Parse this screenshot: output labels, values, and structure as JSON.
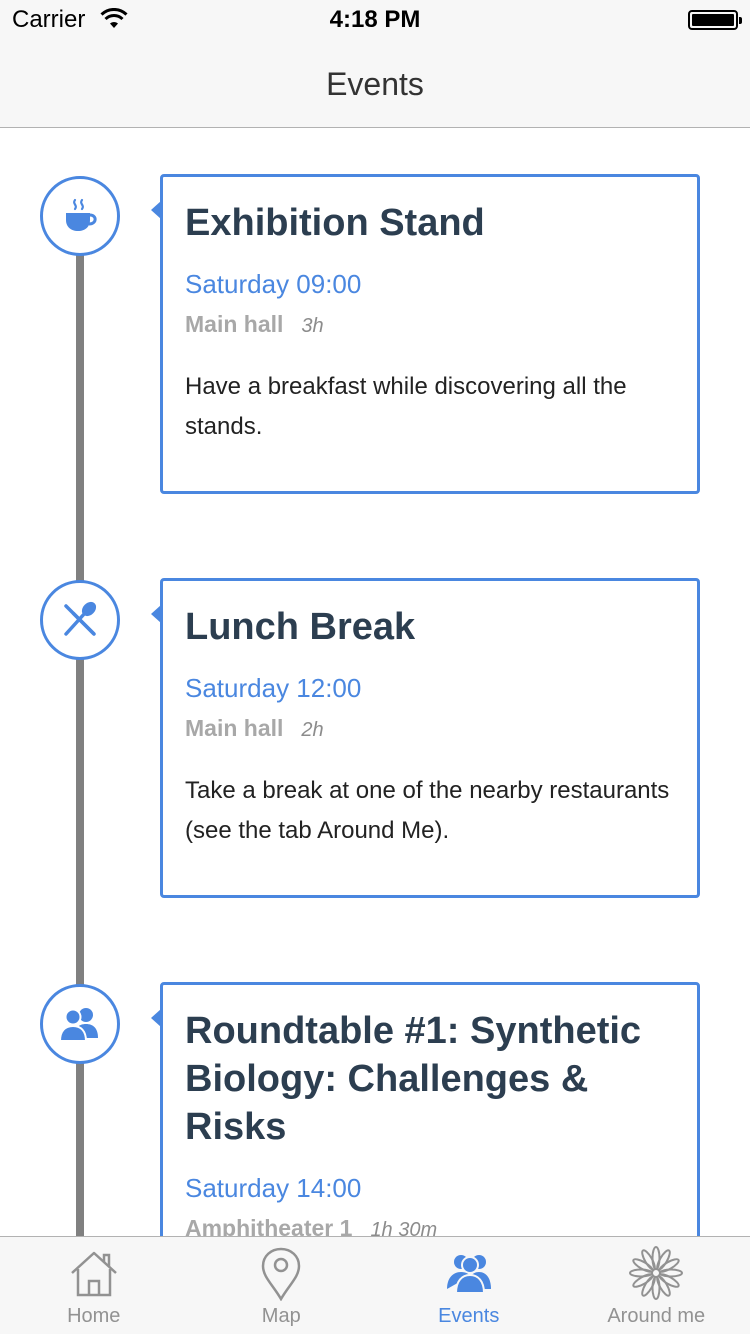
{
  "status_bar": {
    "carrier": "Carrier",
    "time": "4:18 PM"
  },
  "nav": {
    "title": "Events"
  },
  "colors": {
    "accent": "#4a87e0",
    "timeline": "#808080",
    "title_text": "#2c3e50",
    "meta_text": "#a8a8a8"
  },
  "events": [
    {
      "icon": "coffee-cup-icon",
      "title": "Exhibition Stand",
      "time": "Saturday 09:00",
      "location": "Main hall",
      "duration": "3h",
      "description": "Have a breakfast while discovering all the stands."
    },
    {
      "icon": "fork-spoon-icon",
      "title": "Lunch Break",
      "time": "Saturday 12:00",
      "location": "Main hall",
      "duration": "2h",
      "description": "Take a break at one of the nearby restaurants (see the tab Around Me)."
    },
    {
      "icon": "people-icon",
      "title": "Roundtable #1: Synthetic Biology: Challenges & Risks",
      "time": "Saturday 14:00",
      "location": "Amphitheater 1",
      "duration": "1h 30m",
      "description": ""
    }
  ],
  "tabs": [
    {
      "label": "Home",
      "icon": "home-icon",
      "active": false
    },
    {
      "label": "Map",
      "icon": "map-pin-icon",
      "active": false
    },
    {
      "label": "Events",
      "icon": "people-icon",
      "active": true
    },
    {
      "label": "Around me",
      "icon": "flower-icon",
      "active": false
    }
  ]
}
